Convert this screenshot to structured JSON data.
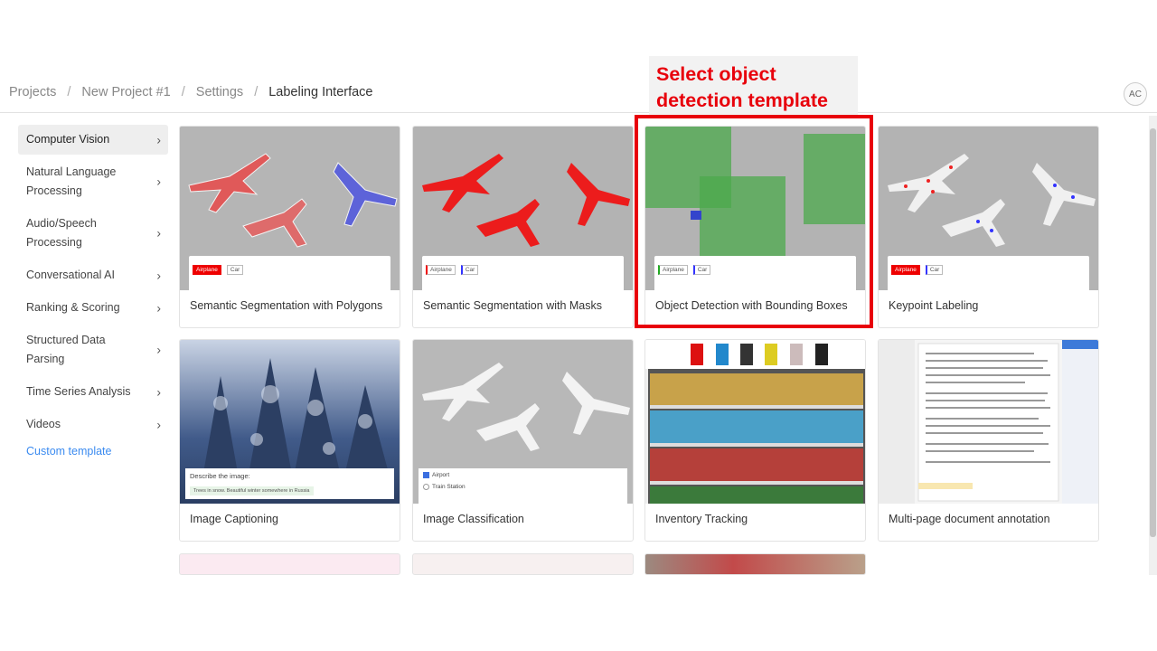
{
  "breadcrumb": {
    "items": [
      "Projects",
      "New Project #1",
      "Settings"
    ],
    "current": "Labeling Interface",
    "separator": "/"
  },
  "user": {
    "initials": "AC"
  },
  "annotation": {
    "line1": "Select object",
    "line2": "detection template",
    "color": "#e8000b"
  },
  "sidebar": {
    "items": [
      {
        "label": "Computer Vision",
        "active": true
      },
      {
        "label": "Natural Language Processing"
      },
      {
        "label": "Audio/Speech Processing"
      },
      {
        "label": "Conversational AI"
      },
      {
        "label": "Ranking & Scoring"
      },
      {
        "label": "Structured Data Parsing"
      },
      {
        "label": "Time Series Analysis"
      },
      {
        "label": "Videos"
      }
    ],
    "chevron": "›",
    "custom_template": "Custom template"
  },
  "templates": [
    {
      "title": "Semantic Segmentation with Polygons",
      "tags": [
        "Airplane",
        "Car"
      ]
    },
    {
      "title": "Semantic Segmentation with Masks",
      "tags": [
        "Airplane",
        "Car"
      ]
    },
    {
      "title": "Object Detection with Bounding Boxes",
      "tags": [
        "Airplane",
        "Car"
      ]
    },
    {
      "title": "Keypoint Labeling",
      "tags": [
        "Airplane",
        "Car"
      ]
    },
    {
      "title": "Image Captioning",
      "prompt": "Describe the image:",
      "caption": "Trees in snow. Beautiful winter somewhere in Russia"
    },
    {
      "title": "Image Classification",
      "choices": [
        "Airport",
        "Train Station"
      ]
    },
    {
      "title": "Inventory Tracking"
    },
    {
      "title": "Multi-page document annotation"
    }
  ],
  "colors": {
    "accent": "#3b8bf0",
    "highlight": "#e8000b"
  }
}
